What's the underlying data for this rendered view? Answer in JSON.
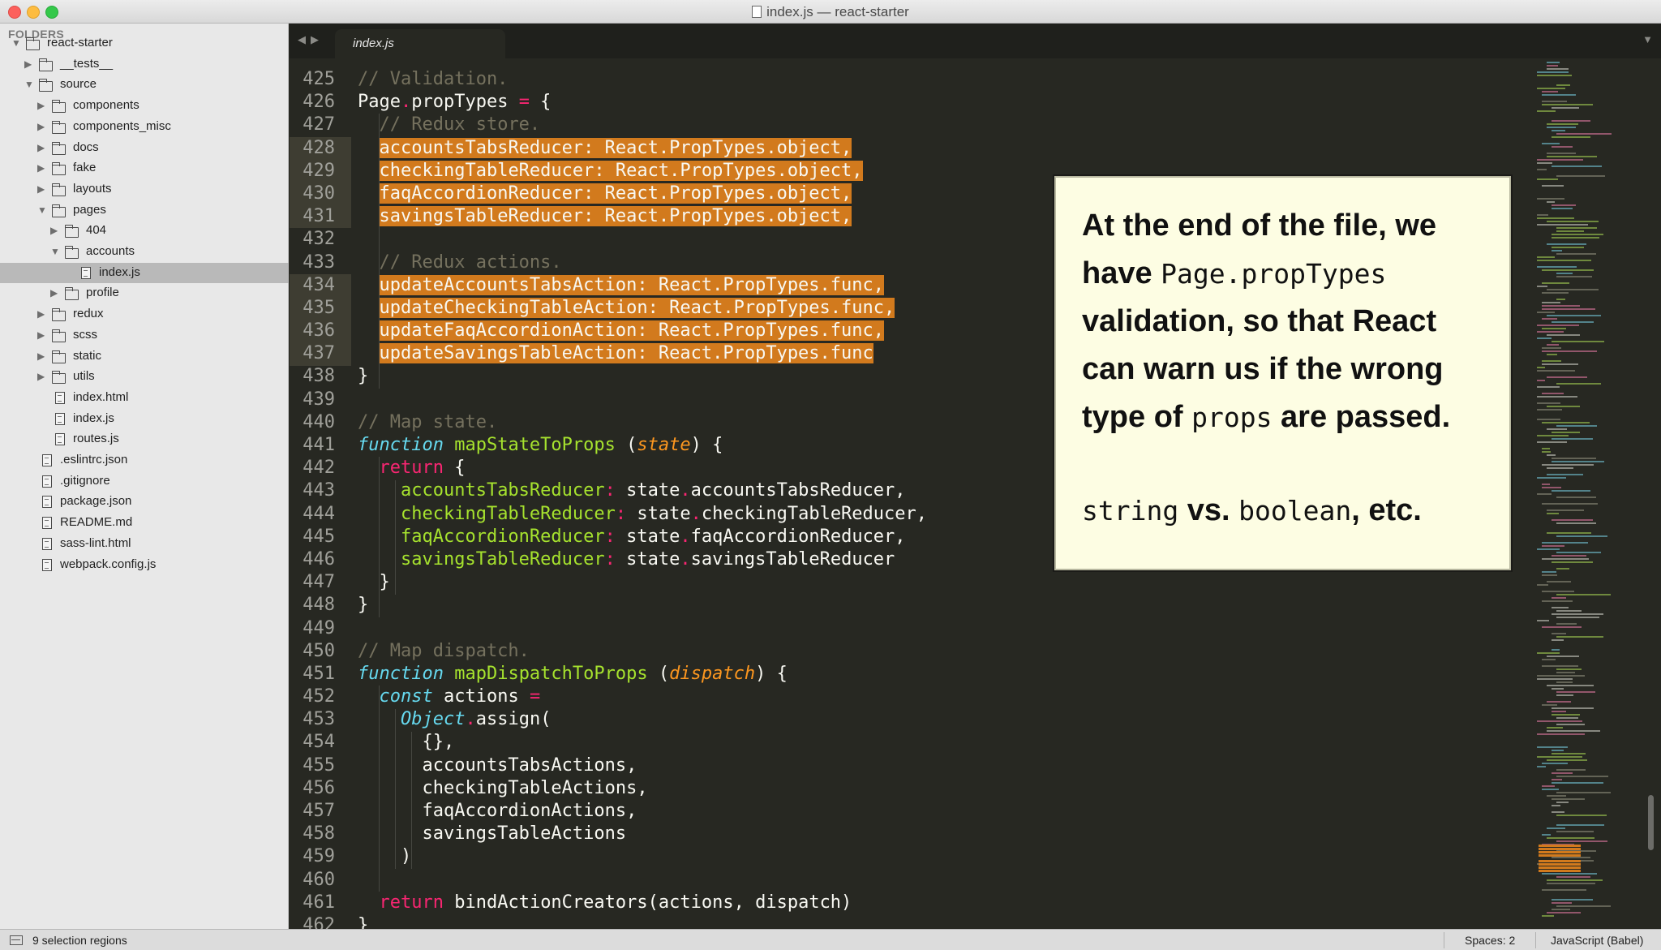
{
  "window": {
    "title": "index.js — react-starter"
  },
  "sidebar": {
    "heading": "FOLDERS",
    "tree": [
      {
        "label": "react-starter",
        "type": "folder",
        "depth": 0,
        "expanded": true
      },
      {
        "label": "__tests__",
        "type": "folder",
        "depth": 1,
        "expanded": false
      },
      {
        "label": "source",
        "type": "folder",
        "depth": 1,
        "expanded": true
      },
      {
        "label": "components",
        "type": "folder",
        "depth": 2,
        "expanded": false
      },
      {
        "label": "components_misc",
        "type": "folder",
        "depth": 2,
        "expanded": false
      },
      {
        "label": "docs",
        "type": "folder",
        "depth": 2,
        "expanded": false
      },
      {
        "label": "fake",
        "type": "folder",
        "depth": 2,
        "expanded": false
      },
      {
        "label": "layouts",
        "type": "folder",
        "depth": 2,
        "expanded": false
      },
      {
        "label": "pages",
        "type": "folder",
        "depth": 2,
        "expanded": true
      },
      {
        "label": "404",
        "type": "folder",
        "depth": 3,
        "expanded": false
      },
      {
        "label": "accounts",
        "type": "folder",
        "depth": 3,
        "expanded": true
      },
      {
        "label": "index.js",
        "type": "file",
        "depth": 4,
        "selected": true
      },
      {
        "label": "profile",
        "type": "folder",
        "depth": 3,
        "expanded": false
      },
      {
        "label": "redux",
        "type": "folder",
        "depth": 2,
        "expanded": false
      },
      {
        "label": "scss",
        "type": "folder",
        "depth": 2,
        "expanded": false
      },
      {
        "label": "static",
        "type": "folder",
        "depth": 2,
        "expanded": false
      },
      {
        "label": "utils",
        "type": "folder",
        "depth": 2,
        "expanded": false
      },
      {
        "label": "index.html",
        "type": "file",
        "depth": 2
      },
      {
        "label": "index.js",
        "type": "file",
        "depth": 2
      },
      {
        "label": "routes.js",
        "type": "file",
        "depth": 2
      },
      {
        "label": ".eslintrc.json",
        "type": "file",
        "depth": 1
      },
      {
        "label": ".gitignore",
        "type": "file",
        "depth": 1
      },
      {
        "label": "package.json",
        "type": "file",
        "depth": 1
      },
      {
        "label": "README.md",
        "type": "file",
        "depth": 1
      },
      {
        "label": "sass-lint.html",
        "type": "file",
        "depth": 1
      },
      {
        "label": "webpack.config.js",
        "type": "file",
        "depth": 1
      }
    ]
  },
  "tabs": [
    {
      "label": "index.js",
      "active": true
    }
  ],
  "editor": {
    "highlighted_lines": [
      428,
      429,
      430,
      431,
      434,
      435,
      436,
      437
    ],
    "lines": [
      {
        "n": "425",
        "tokens": [
          [
            "cm",
            "// Validation."
          ]
        ]
      },
      {
        "n": "426",
        "tokens": [
          [
            "",
            "Page"
          ],
          [
            "op",
            "."
          ],
          [
            "",
            "propTypes "
          ],
          [
            "op",
            "="
          ],
          [
            "",
            " {"
          ]
        ]
      },
      {
        "n": "427",
        "tokens": [
          [
            "",
            "  "
          ],
          [
            "cm",
            "// Redux store."
          ]
        ]
      },
      {
        "n": "428",
        "tokens": [
          [
            "",
            "  "
          ],
          [
            "hl",
            "accountsTabsReducer: React.PropTypes.object,"
          ]
        ]
      },
      {
        "n": "429",
        "tokens": [
          [
            "",
            "  "
          ],
          [
            "hl",
            "checkingTableReducer: React.PropTypes.object,"
          ]
        ]
      },
      {
        "n": "430",
        "tokens": [
          [
            "",
            "  "
          ],
          [
            "hl",
            "faqAccordionReducer: React.PropTypes.object,"
          ]
        ]
      },
      {
        "n": "431",
        "tokens": [
          [
            "",
            "  "
          ],
          [
            "hl",
            "savingsTableReducer: React.PropTypes.object,"
          ]
        ]
      },
      {
        "n": "432",
        "tokens": []
      },
      {
        "n": "433",
        "tokens": [
          [
            "",
            "  "
          ],
          [
            "cm",
            "// Redux actions."
          ]
        ]
      },
      {
        "n": "434",
        "tokens": [
          [
            "",
            "  "
          ],
          [
            "hl",
            "updateAccountsTabsAction: React.PropTypes.func,"
          ]
        ]
      },
      {
        "n": "435",
        "tokens": [
          [
            "",
            "  "
          ],
          [
            "hl",
            "updateCheckingTableAction: React.PropTypes.func,"
          ]
        ]
      },
      {
        "n": "436",
        "tokens": [
          [
            "",
            "  "
          ],
          [
            "hl",
            "updateFaqAccordionAction: React.PropTypes.func,"
          ]
        ]
      },
      {
        "n": "437",
        "tokens": [
          [
            "",
            "  "
          ],
          [
            "hl",
            "updateSavingsTableAction: React.PropTypes.func"
          ]
        ]
      },
      {
        "n": "438",
        "tokens": [
          [
            "",
            "}"
          ]
        ]
      },
      {
        "n": "439",
        "tokens": []
      },
      {
        "n": "440",
        "tokens": [
          [
            "cm",
            "// Map state."
          ]
        ]
      },
      {
        "n": "441",
        "tokens": [
          [
            "kw",
            "function"
          ],
          [
            "",
            " "
          ],
          [
            "fn",
            "mapStateToProps"
          ],
          [
            "",
            " ("
          ],
          [
            "pa",
            "state"
          ],
          [
            "",
            ") {"
          ]
        ]
      },
      {
        "n": "442",
        "tokens": [
          [
            "",
            "  "
          ],
          [
            "kr",
            "return"
          ],
          [
            "",
            " {"
          ]
        ]
      },
      {
        "n": "443",
        "tokens": [
          [
            "",
            "    "
          ],
          [
            "pr",
            "accountsTabsReducer"
          ],
          [
            "op",
            ":"
          ],
          [
            "",
            " state"
          ],
          [
            "op",
            "."
          ],
          [
            "",
            "accountsTabsReducer,"
          ]
        ]
      },
      {
        "n": "444",
        "tokens": [
          [
            "",
            "    "
          ],
          [
            "pr",
            "checkingTableReducer"
          ],
          [
            "op",
            ":"
          ],
          [
            "",
            " state"
          ],
          [
            "op",
            "."
          ],
          [
            "",
            "checkingTableReducer,"
          ]
        ]
      },
      {
        "n": "445",
        "tokens": [
          [
            "",
            "    "
          ],
          [
            "pr",
            "faqAccordionReducer"
          ],
          [
            "op",
            ":"
          ],
          [
            "",
            " state"
          ],
          [
            "op",
            "."
          ],
          [
            "",
            "faqAccordionReducer,"
          ]
        ]
      },
      {
        "n": "446",
        "tokens": [
          [
            "",
            "    "
          ],
          [
            "pr",
            "savingsTableReducer"
          ],
          [
            "op",
            ":"
          ],
          [
            "",
            " state"
          ],
          [
            "op",
            "."
          ],
          [
            "",
            "savingsTableReducer"
          ]
        ]
      },
      {
        "n": "447",
        "tokens": [
          [
            "",
            "  }"
          ]
        ]
      },
      {
        "n": "448",
        "tokens": [
          [
            "",
            "}"
          ]
        ]
      },
      {
        "n": "449",
        "tokens": []
      },
      {
        "n": "450",
        "tokens": [
          [
            "cm",
            "// Map dispatch."
          ]
        ]
      },
      {
        "n": "451",
        "tokens": [
          [
            "kw",
            "function"
          ],
          [
            "",
            " "
          ],
          [
            "fn",
            "mapDispatchToProps"
          ],
          [
            "",
            " ("
          ],
          [
            "pa",
            "dispatch"
          ],
          [
            "",
            ") {"
          ]
        ]
      },
      {
        "n": "452",
        "tokens": [
          [
            "",
            "  "
          ],
          [
            "kw",
            "const"
          ],
          [
            "",
            " actions "
          ],
          [
            "op",
            "="
          ]
        ]
      },
      {
        "n": "453",
        "tokens": [
          [
            "",
            "    "
          ],
          [
            "kw",
            "Object"
          ],
          [
            "op",
            "."
          ],
          [
            "",
            "assign("
          ]
        ]
      },
      {
        "n": "454",
        "tokens": [
          [
            "",
            "      {},"
          ]
        ]
      },
      {
        "n": "455",
        "tokens": [
          [
            "",
            "      accountsTabsActions,"
          ]
        ]
      },
      {
        "n": "456",
        "tokens": [
          [
            "",
            "      checkingTableActions,"
          ]
        ]
      },
      {
        "n": "457",
        "tokens": [
          [
            "",
            "      faqAccordionActions,"
          ]
        ]
      },
      {
        "n": "458",
        "tokens": [
          [
            "",
            "      savingsTableActions"
          ]
        ]
      },
      {
        "n": "459",
        "tokens": [
          [
            "",
            "    )"
          ]
        ]
      },
      {
        "n": "460",
        "tokens": []
      },
      {
        "n": "461",
        "tokens": [
          [
            "",
            "  "
          ],
          [
            "kr",
            "return"
          ],
          [
            "",
            " bindActionCreators(actions, dispatch)"
          ]
        ]
      },
      {
        "n": "462",
        "tokens": [
          [
            "",
            "}"
          ]
        ]
      }
    ]
  },
  "callout": {
    "t1": "At the end of the file, we have ",
    "c1": "Page.propTypes",
    "t2": " validation, so that React can warn us if the wrong type of ",
    "c2": "props",
    "t3": " are passed.",
    "c3": "string",
    "t4": " vs. ",
    "c4": "boolean",
    "t5": ", etc."
  },
  "statusbar": {
    "selection": "9 selection regions",
    "indent": "Spaces: 2",
    "syntax": "JavaScript (Babel)"
  },
  "colors": {
    "editor_bg": "#272822",
    "selection_highlight": "#d27a1d",
    "comment": "#75715e",
    "keyword": "#66d9ef",
    "function": "#a6e22e",
    "return": "#f92672",
    "parameter": "#fd971f"
  }
}
